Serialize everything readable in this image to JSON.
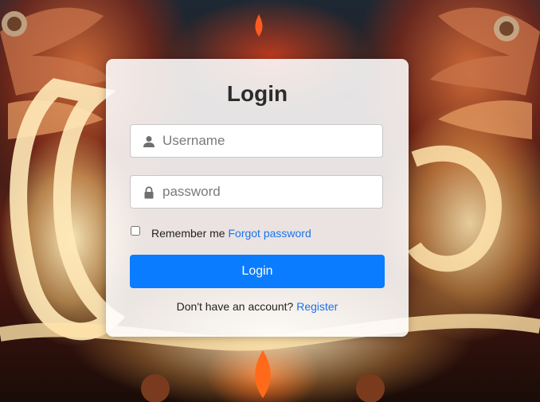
{
  "login_card": {
    "title": "Login",
    "username": {
      "placeholder": "Username",
      "value": "",
      "icon": "user-icon"
    },
    "password": {
      "placeholder": "password",
      "value": "",
      "icon": "lock-icon"
    },
    "remember_label": "Remember me",
    "remember_checked": false,
    "forgot_link": "Forgot password",
    "submit_label": "Login",
    "register_prompt": "Don't have an account?",
    "register_link": "Register"
  },
  "colors": {
    "primary": "#0a7cff",
    "link": "#1a73e8",
    "card": "#ffffff"
  }
}
